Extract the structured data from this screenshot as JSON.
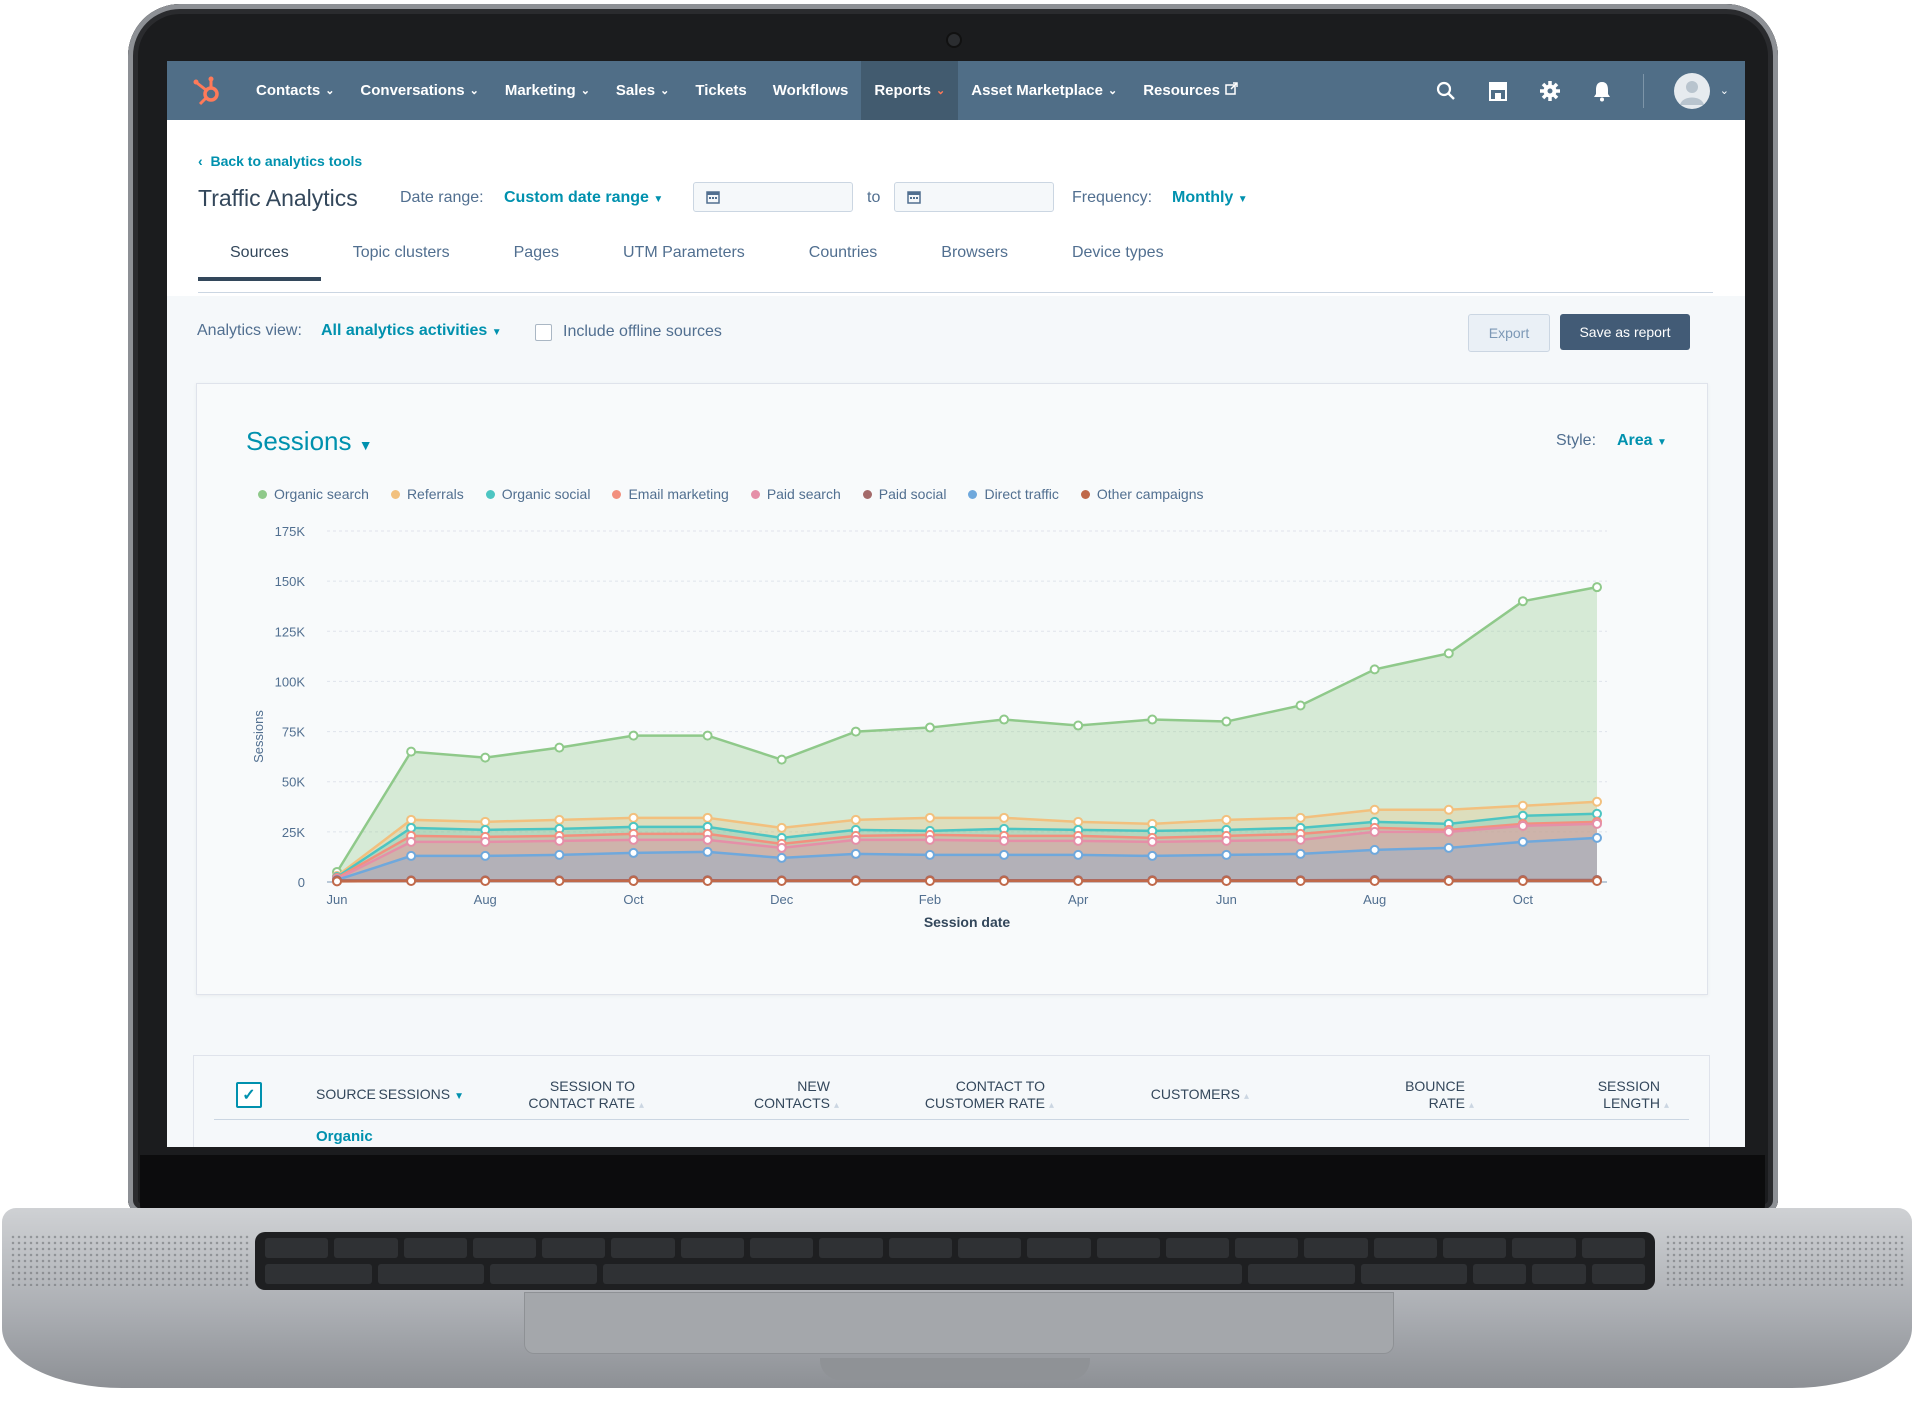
{
  "nav": {
    "items": [
      {
        "label": "Contacts",
        "chevron": true
      },
      {
        "label": "Conversations",
        "chevron": true
      },
      {
        "label": "Marketing",
        "chevron": true
      },
      {
        "label": "Sales",
        "chevron": true
      },
      {
        "label": "Tickets",
        "chevron": false
      },
      {
        "label": "Workflows",
        "chevron": false
      },
      {
        "label": "Reports",
        "chevron": true,
        "active": true
      },
      {
        "label": "Asset Marketplace",
        "chevron": true
      },
      {
        "label": "Resources",
        "chevron": false,
        "external": true
      }
    ],
    "accent": "#506e87"
  },
  "header": {
    "back_link": "Back to analytics tools",
    "title": "Traffic Analytics",
    "date_range_label": "Date range:",
    "date_range_value": "Custom date range",
    "to_label": "to",
    "frequency_label": "Frequency:",
    "frequency_value": "Monthly"
  },
  "tabs": [
    "Sources",
    "Topic clusters",
    "Pages",
    "UTM Parameters",
    "Countries",
    "Browsers",
    "Device types"
  ],
  "toolbar": {
    "analytics_view_label": "Analytics view:",
    "analytics_view_value": "All analytics activities",
    "offline_label": "Include offline sources",
    "export_label": "Export",
    "save_label": "Save as report"
  },
  "card": {
    "title": "Sessions",
    "style_label": "Style:",
    "style_value": "Area"
  },
  "chart_data": {
    "type": "area",
    "xlabel": "Session date",
    "ylabel": "Sessions",
    "ylim": [
      0,
      175000
    ],
    "y_ticks": [
      "0",
      "25K",
      "50K",
      "75K",
      "100K",
      "125K",
      "150K",
      "175K"
    ],
    "x_tick_labels": [
      "Jun",
      "Aug",
      "Oct",
      "Dec",
      "Feb",
      "Apr",
      "Jun",
      "Aug",
      "Oct"
    ],
    "grid": true,
    "legend_position": "top-left",
    "series": [
      {
        "name": "Organic search",
        "color": "#8fc98a",
        "values": [
          5000,
          65000,
          62000,
          67000,
          73000,
          73000,
          61000,
          75000,
          77000,
          81000,
          78000,
          81000,
          80000,
          88000,
          106000,
          114000,
          140000,
          147000
        ]
      },
      {
        "name": "Referrals",
        "color": "#f2c07e",
        "values": [
          3000,
          31000,
          30000,
          31000,
          32000,
          32000,
          27000,
          31000,
          32000,
          32000,
          30000,
          29000,
          31000,
          32000,
          36000,
          36000,
          38000,
          40000
        ]
      },
      {
        "name": "Organic social",
        "color": "#4dc5c2",
        "values": [
          2500,
          27000,
          26000,
          26500,
          27500,
          27500,
          22000,
          26000,
          25500,
          26500,
          26000,
          25500,
          26000,
          27000,
          30000,
          29000,
          33000,
          34000
        ]
      },
      {
        "name": "Email marketing",
        "color": "#f2907e",
        "values": [
          2000,
          23000,
          22500,
          23000,
          24000,
          24000,
          19000,
          23000,
          23500,
          23000,
          23000,
          22000,
          23000,
          24000,
          27000,
          26000,
          29000,
          30000
        ]
      },
      {
        "name": "Paid search",
        "color": "#e58fa8",
        "values": [
          1500,
          20000,
          20000,
          20500,
          21000,
          21000,
          17000,
          21000,
          21000,
          20500,
          20500,
          20000,
          20500,
          21000,
          25000,
          25000,
          28000,
          29000
        ]
      },
      {
        "name": "Paid social",
        "color": "#a46a6a",
        "values": [
          800,
          800,
          800,
          800,
          900,
          900,
          800,
          900,
          900,
          900,
          900,
          900,
          900,
          900,
          1000,
          1000,
          1000,
          1000
        ]
      },
      {
        "name": "Direct traffic",
        "color": "#6fa8dc",
        "values": [
          1000,
          13000,
          13000,
          13500,
          14500,
          15000,
          12000,
          14000,
          13500,
          13500,
          13500,
          13000,
          13500,
          14000,
          16000,
          17000,
          20000,
          22000
        ]
      },
      {
        "name": "Other campaigns",
        "color": "#c0694a",
        "values": [
          300,
          500,
          500,
          500,
          500,
          500,
          500,
          500,
          500,
          500,
          500,
          500,
          500,
          500,
          500,
          500,
          500,
          500
        ]
      }
    ]
  },
  "table": {
    "headers": [
      "SOURCE",
      "SESSIONS",
      "SESSION TO CONTACT RATE",
      "NEW CONTACTS",
      "CONTACT TO CUSTOMER RATE",
      "CUSTOMERS",
      "BOUNCE RATE",
      "SESSION LENGTH"
    ],
    "first_row_label": "Organic"
  }
}
